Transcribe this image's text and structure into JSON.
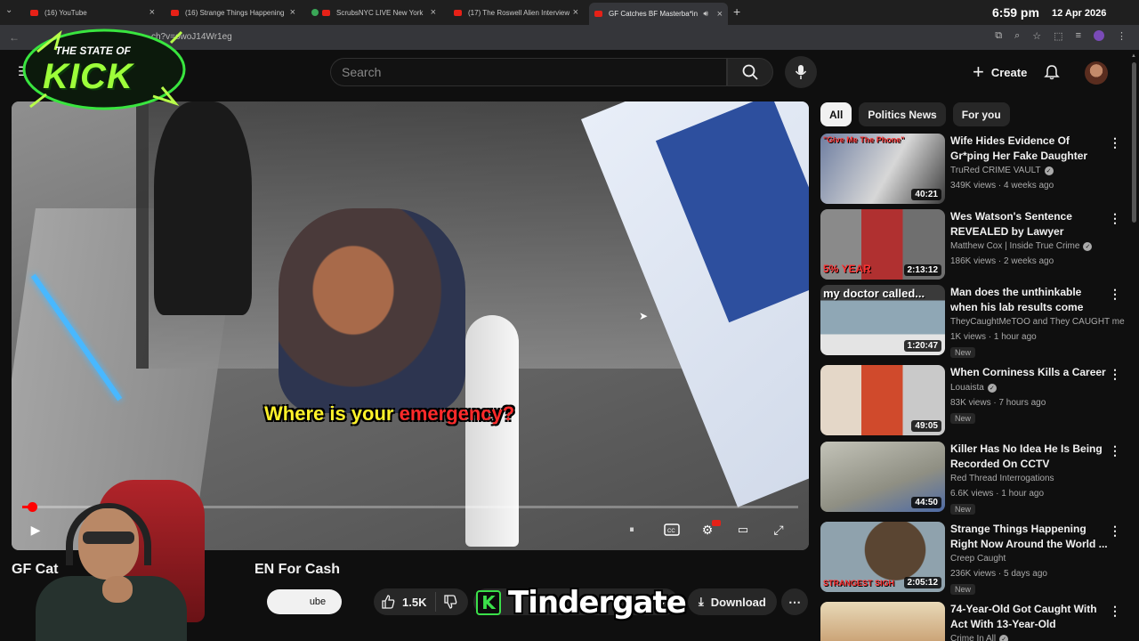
{
  "browser": {
    "tabs": [
      {
        "title": "(16) YouTube",
        "favicon": "youtube-icon"
      },
      {
        "title": "(16) Strange Things Happening",
        "favicon": "youtube-icon"
      },
      {
        "title": "ScrubsNYC LIVE New York C",
        "favicon": "live-icon"
      },
      {
        "title": "(17) The Roswell Alien Interview",
        "favicon": "youtube-icon"
      },
      {
        "title": "GF Catches BF Masterba*in",
        "favicon": "youtube-icon"
      }
    ],
    "url": "ch?v=owoJ14Wr1eg",
    "clock_time": "6:59 pm",
    "clock_date": "12 Apr 2026"
  },
  "header": {
    "search_placeholder": "Search",
    "create_label": "Create"
  },
  "player": {
    "subtitle_main": "Where is your ",
    "subtitle_highlight": "emergency?",
    "progress": 0.01,
    "accent": "#ff0000"
  },
  "video": {
    "title_start": "GF Cat",
    "title_end": "EN For Cash",
    "subscribe_partial": "ube",
    "likes": "1.5K",
    "share_partial": "e",
    "download_label": "Download"
  },
  "overlay": {
    "brand_badge": "K",
    "brand_text": "Tindergate",
    "logo_line1": "THE STATE OF",
    "logo_line2": "KICK"
  },
  "sidebar": {
    "chips": [
      "All",
      "Politics News",
      "For you"
    ],
    "recommendations": [
      {
        "title": "Wife Hides Evidence Of Gr*ping Her Fake Daughter",
        "channel": "TruRed CRIME VAULT",
        "verified": true,
        "meta": "349K views · 4 weeks ago",
        "duration": "40:21",
        "new": "",
        "thumb_caption": "\"Give Me The Phone\""
      },
      {
        "title": "Wes Watson's Sentence REVEALED by Lawyer",
        "channel": "Matthew Cox | Inside True Crime",
        "verified": true,
        "meta": "186K views · 2 weeks ago",
        "duration": "2:13:12",
        "new": "",
        "thumb_caption": "5% YEAR"
      },
      {
        "title": "Man does the unthinkable when his lab results come back.",
        "channel": "TheyCaughtMeTOO and They CAUGHT me",
        "verified": false,
        "meta": "1K views · 1 hour ago",
        "duration": "1:20:47",
        "new": "New",
        "thumb_caption": "my doctor called..."
      },
      {
        "title": "When Corniness Kills a Career",
        "channel": "Louaista",
        "verified": true,
        "meta": "83K views · 7 hours ago",
        "duration": "49:05",
        "new": "New",
        "thumb_caption": ""
      },
      {
        "title": "Killer Has No Idea He Is Being Recorded On CCTV",
        "channel": "Red Thread Interrogations",
        "verified": false,
        "meta": "6.6K views · 1 hour ago",
        "duration": "44:50",
        "new": "New",
        "thumb_caption": ""
      },
      {
        "title": "Strange Things Happening Right Now Around the World ...",
        "channel": "Creep Caught",
        "verified": false,
        "meta": "236K views · 5 days ago",
        "duration": "2:05:12",
        "new": "New",
        "thumb_caption": "STRANGEST SIGH"
      },
      {
        "title": "74-Year-Old Got Caught With Act With 13-Year-Old",
        "channel": "Crime In All",
        "verified": true,
        "meta": "",
        "duration": "",
        "new": "",
        "thumb_caption": ""
      }
    ]
  }
}
